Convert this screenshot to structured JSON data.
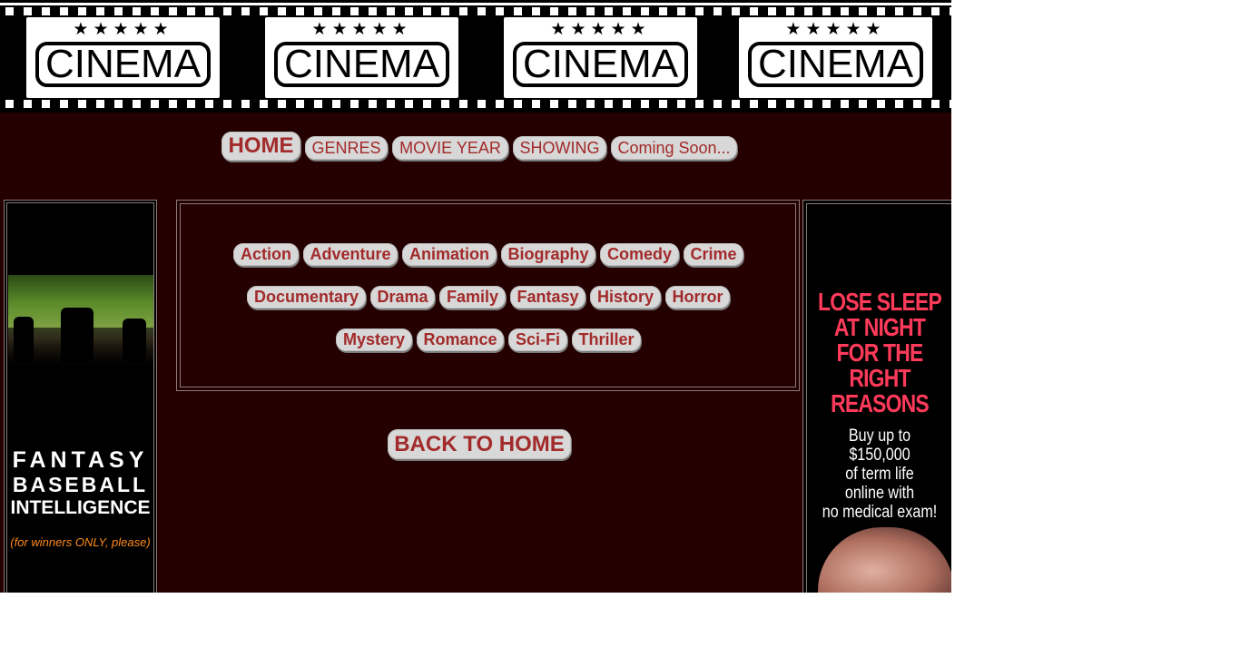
{
  "banner": {
    "frames": [
      {
        "stars": "★★★★★",
        "word": "CINEMA"
      },
      {
        "stars": "★★★★★",
        "word": "CINEMA"
      },
      {
        "stars": "★★★★★",
        "word": "CINEMA"
      },
      {
        "stars": "★★★★★",
        "word": "CINEMA"
      }
    ]
  },
  "nav": {
    "home": "HOME",
    "genres": "GENRES",
    "movie_year": "MOVIE YEAR",
    "showing": "SHOWING",
    "coming_soon": "Coming Soon..."
  },
  "genres": [
    "Action",
    "Adventure",
    "Animation",
    "Biography",
    "Comedy",
    "Crime",
    "Documentary",
    "Drama",
    "Family",
    "Fantasy",
    "History",
    "Horror",
    "Mystery",
    "Romance",
    "Sci-Fi",
    "Thriller"
  ],
  "back_home": "BACK TO HOME",
  "ad_left": {
    "line1": "FANTASY",
    "line2": "BASEBALL",
    "line3": "INTELLIGENCE",
    "tagline": "(for winners ONLY, please)"
  },
  "ad_right": {
    "headline": [
      "LOSE SLEEP",
      "AT NIGHT",
      "FOR THE",
      "RIGHT",
      "REASONS"
    ],
    "sub": [
      "Buy up to",
      "$150,000",
      "of term life",
      "online with",
      "no medical exam!"
    ]
  },
  "colors": {
    "page_bg": "#250000",
    "button_bg": "#d8d8d8",
    "button_text": "#a22a2a",
    "ad_headline": "#ff3a5a",
    "ad_tagline": "#ff8a1a"
  }
}
